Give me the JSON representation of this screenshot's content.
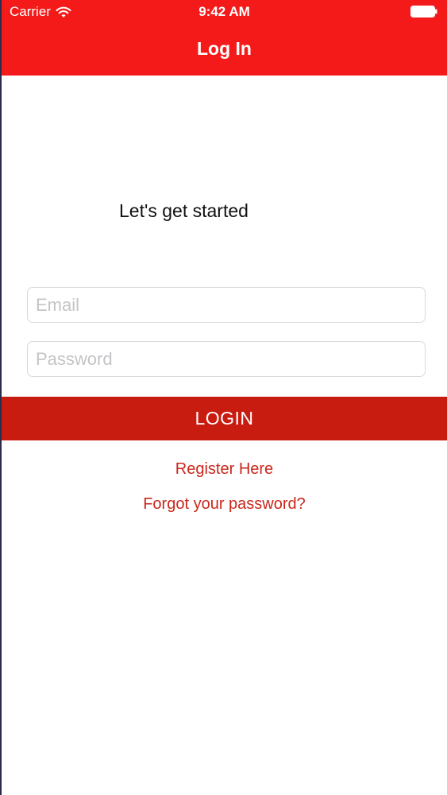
{
  "status_bar": {
    "carrier": "Carrier",
    "time": "9:42 AM",
    "icons": [
      "wifi-icon",
      "battery-icon"
    ]
  },
  "header": {
    "title": "Log In"
  },
  "main": {
    "tagline": "Let's get started",
    "email_placeholder": "Email",
    "password_placeholder": "Password",
    "login_label": "LOGIN",
    "register_link": "Register Here",
    "forgot_link": "Forgot your password?"
  },
  "colors": {
    "header_red": "#f41a1a",
    "button_red": "#c91c10",
    "link_red": "#c9271c"
  }
}
